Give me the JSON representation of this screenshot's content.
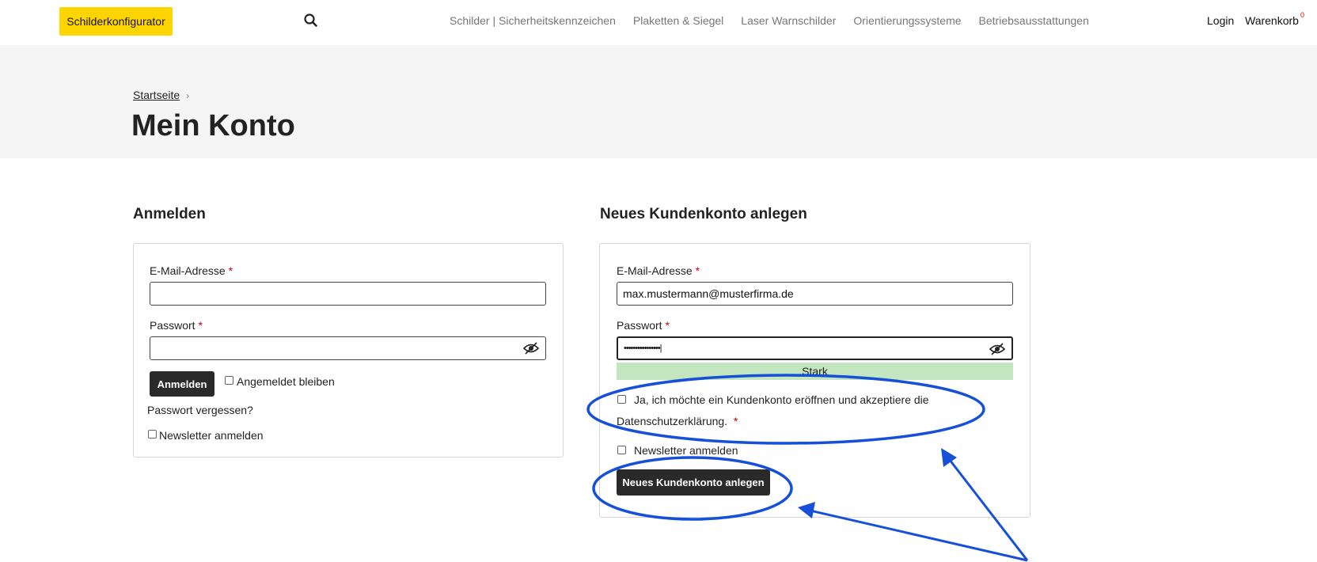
{
  "header": {
    "brand_button": "Schilderkonfigurator",
    "nav": [
      "Schilder | Sicherheitskennzeichen",
      "Plaketten & Siegel",
      "Laser Warnschilder",
      "Orientierungssysteme",
      "Betriebsausstattungen"
    ],
    "login": "Login",
    "cart": "Warenkorb",
    "cart_count": "0"
  },
  "breadcrumb": {
    "home": "Startseite",
    "separator": "›"
  },
  "page_title": "Mein Konto",
  "login_section": {
    "title": "Anmelden",
    "email_label": "E-Mail-Adresse",
    "email_value": "",
    "password_label": "Passwort",
    "password_value": "",
    "submit": "Anmelden",
    "remember": "Angemeldet bleiben",
    "forgot": "Passwort vergessen?",
    "newsletter": "Newsletter anmelden"
  },
  "register_section": {
    "title": "Neues Kundenkonto anlegen",
    "email_label": "E-Mail-Adresse",
    "email_value": "max.mustermann@musterfirma.de",
    "password_label": "Passwort",
    "password_value": "••••••••••••••••|",
    "strength": "Stark",
    "privacy_line1": "Ja, ich möchte ein Kundenkonto eröffnen und akzeptiere die",
    "privacy_line2": "Datenschutzerklärung.",
    "newsletter": "Newsletter anmelden",
    "submit": "Neues Kundenkonto anlegen"
  },
  "required_mark": "*",
  "colors": {
    "brand": "#ffd500",
    "annotation": "#1650d8",
    "strength": "#c3e5bf",
    "required": "#cc0000"
  }
}
